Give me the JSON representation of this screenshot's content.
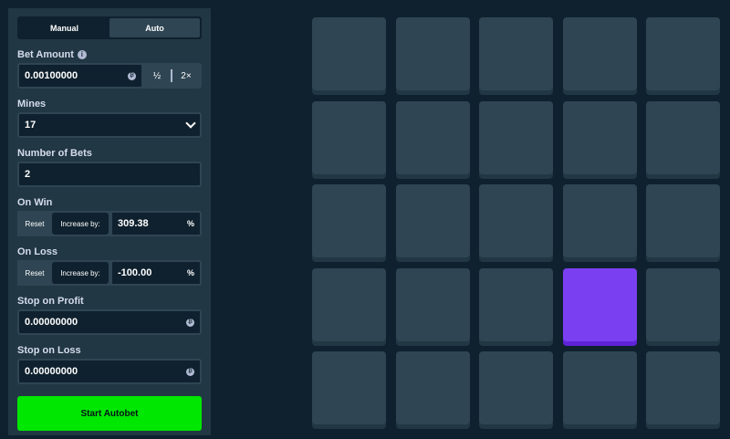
{
  "mode_tabs": [
    "Manual",
    "Auto"
  ],
  "bet_amount": {
    "label": "Bet Amount",
    "value": "0.00100000",
    "half": "½",
    "double": "2×"
  },
  "mines": {
    "label": "Mines",
    "value": "17"
  },
  "number_of_bets": {
    "label": "Number of Bets",
    "value": "2"
  },
  "on_win": {
    "label": "On Win",
    "reset": "Reset",
    "increase": "Increase by:",
    "value": "309.38",
    "unit": "%"
  },
  "on_loss": {
    "label": "On Loss",
    "reset": "Reset",
    "increase": "Increase by:",
    "value": "-100.00",
    "unit": "%"
  },
  "stop_on_profit": {
    "label": "Stop on Profit",
    "value": "0.00000000"
  },
  "stop_on_loss": {
    "label": "Stop on Loss",
    "value": "0.00000000"
  },
  "start_button": "Start Autobet",
  "grid": {
    "rows": 5,
    "cols": 5,
    "selected": [
      [
        3,
        3
      ]
    ]
  },
  "colors": {
    "accent": "#00e701",
    "selected_tile": "#7b3ff2",
    "tile": "#2f4553",
    "background": "#0f212e"
  },
  "icons": {
    "info": "info-icon",
    "coin": "coin-icon",
    "dropdown": "chevron-down-icon"
  }
}
